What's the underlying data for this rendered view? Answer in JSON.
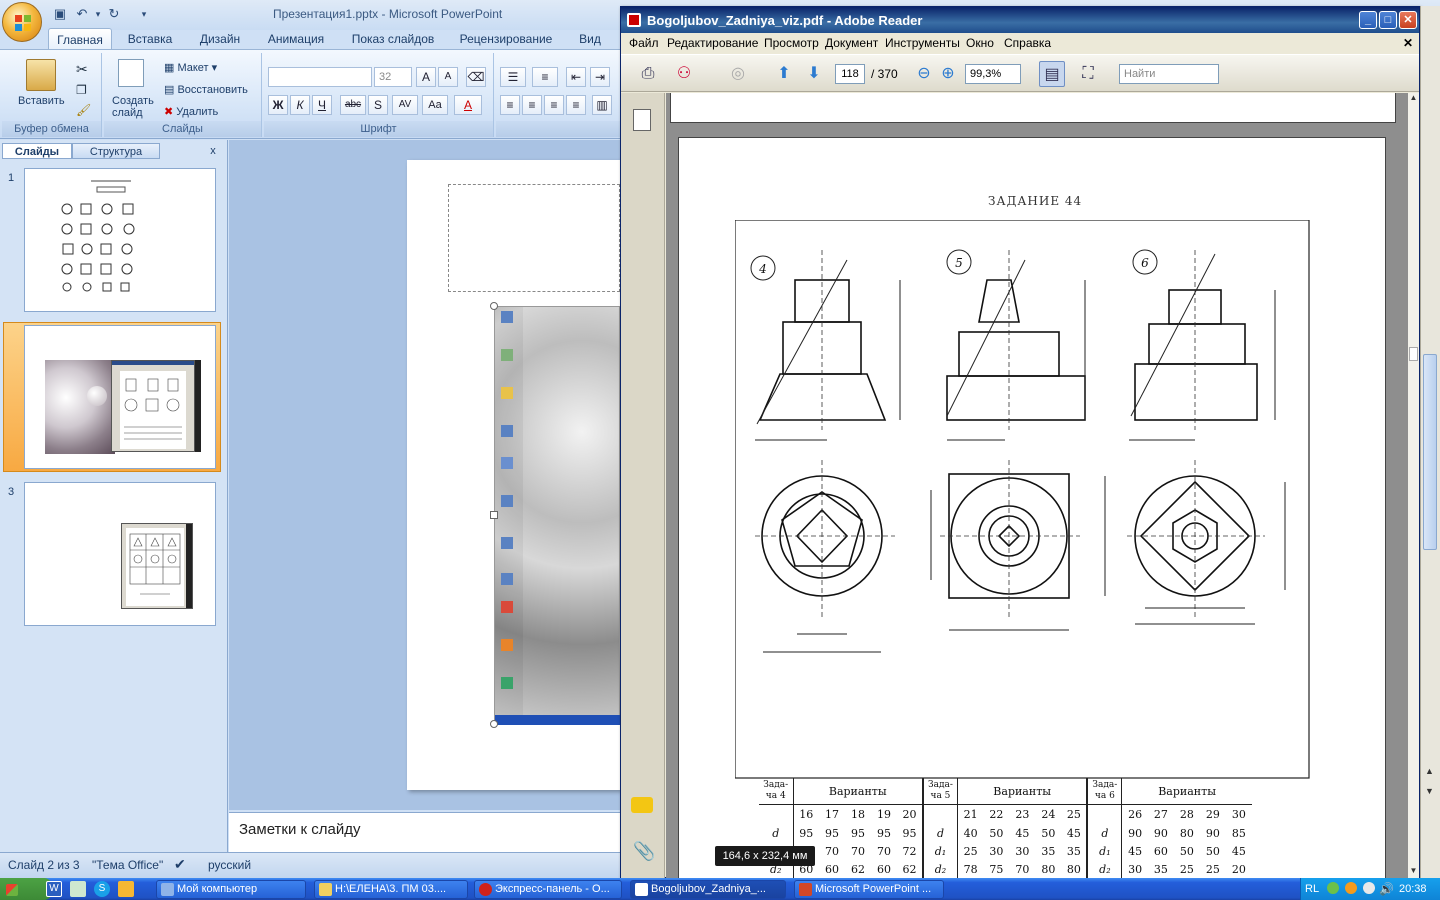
{
  "powerpoint": {
    "title": "Презентация1.pptx - Microsoft PowerPoint",
    "tabs": [
      "Главная",
      "Вставка",
      "Дизайн",
      "Анимация",
      "Показ слайдов",
      "Рецензирование",
      "Вид"
    ],
    "clipboard": {
      "paste": "Вставить",
      "group": "Буфер обмена"
    },
    "slides_group": {
      "create": "Создать слайд",
      "layout": "Макет",
      "reset": "Восстановить",
      "delete": "Удалить",
      "group": "Слайды"
    },
    "font_group": {
      "size": "32",
      "group": "Шрифт",
      "buttons": [
        "Ж",
        "К",
        "Ч",
        "abc",
        "S",
        "AV",
        "Aa",
        "A"
      ]
    },
    "pane_tabs": {
      "slides": "Слайды",
      "outline": "Структура",
      "close": "x"
    },
    "slide_numbers": [
      "1",
      "2",
      "3"
    ],
    "notes_placeholder": "Заметки к слайду",
    "status": {
      "slide": "Слайд 2 из 3",
      "theme": "\"Тема Office\"",
      "language": "русский"
    }
  },
  "reader": {
    "title": "Bogoljubov_Zadniya_viz.pdf - Adobe Reader",
    "menu": [
      "Файл",
      "Редактирование",
      "Просмотр",
      "Документ",
      "Инструменты",
      "Окно",
      "Справка"
    ],
    "page_current": "118",
    "page_total": "/ 370",
    "zoom": "99,3%",
    "search_placeholder": "Найти",
    "page_dimensions": "164,6 x 232,4 мм",
    "doc": {
      "heading": "ЗАДАНИЕ 44",
      "fig_labels": [
        "4",
        "5",
        "6"
      ],
      "table": {
        "task_labels": [
          "Зада-ча 4",
          "Зада-ча 5",
          "Зада-ча 6"
        ],
        "variants_label": "Варианты",
        "variants": [
          [
            "16",
            "17",
            "18",
            "19",
            "20"
          ],
          [
            "21",
            "22",
            "23",
            "24",
            "25"
          ],
          [
            "26",
            "27",
            "28",
            "29",
            "30"
          ]
        ],
        "row_labels": [
          "d",
          "d₁",
          "d₂"
        ],
        "rows_task4": [
          [
            "95",
            "95",
            "95",
            "95",
            "95"
          ],
          [
            "70",
            "70",
            "70",
            "70",
            "72"
          ],
          [
            "60",
            "60",
            "62",
            "60",
            "62"
          ]
        ],
        "rows_task5": [
          [
            "40",
            "50",
            "45",
            "50",
            "45"
          ],
          [
            "25",
            "30",
            "30",
            "35",
            "35"
          ],
          [
            "78",
            "75",
            "70",
            "80",
            "80"
          ]
        ],
        "rows_task6": [
          [
            "90",
            "90",
            "80",
            "90",
            "85"
          ],
          [
            "45",
            "60",
            "50",
            "50",
            "45"
          ],
          [
            "30",
            "35",
            "25",
            "25",
            "20"
          ]
        ]
      }
    }
  },
  "taskbar": {
    "start": "пуск",
    "items": [
      "Мой компьютер",
      "H:\\ЕЛЕНА\\3. ПМ 03....",
      "Экспресс-панель - О...",
      "Bogoljubov_Zadniya_...",
      "Microsoft PowerPoint ..."
    ],
    "lang": "RL",
    "clock": "20:38"
  }
}
